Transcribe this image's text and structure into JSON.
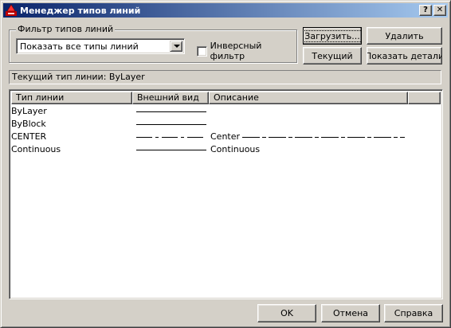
{
  "window": {
    "title": "Менеджер типов линий",
    "help_btn": "?",
    "close_btn": "✕"
  },
  "filter": {
    "legend": "Фильтр типов линий",
    "combo_value": "Показать все типы линий",
    "invert_label": "Инверсный фильтр",
    "invert_checked": false
  },
  "buttons": {
    "load": "Загрузить...",
    "delete": "Удалить",
    "current": "Текущий",
    "details": "Показать детали",
    "ok": "OK",
    "cancel": "Отмена",
    "help": "Справка"
  },
  "current_linetype": {
    "label": "Текущий тип линии:",
    "value": "ByLayer"
  },
  "table": {
    "headers": {
      "linetype": "Тип линии",
      "appearance": "Внешний вид",
      "description": "Описание"
    },
    "rows": [
      {
        "name": "ByLayer",
        "appearance": "solid",
        "description": "",
        "desc_pattern": ""
      },
      {
        "name": "ByBlock",
        "appearance": "solid",
        "description": "",
        "desc_pattern": ""
      },
      {
        "name": "CENTER",
        "appearance": "center",
        "description": "Center",
        "desc_pattern": "center"
      },
      {
        "name": "Continuous",
        "appearance": "solid",
        "description": "Continuous",
        "desc_pattern": ""
      }
    ]
  },
  "colors": {
    "titlebar_start": "#0a246a",
    "titlebar_end": "#a6caf0",
    "face": "#d4d0c8"
  },
  "icons": {
    "title": "autocad-app-icon",
    "combo": "chevron-down-icon"
  }
}
